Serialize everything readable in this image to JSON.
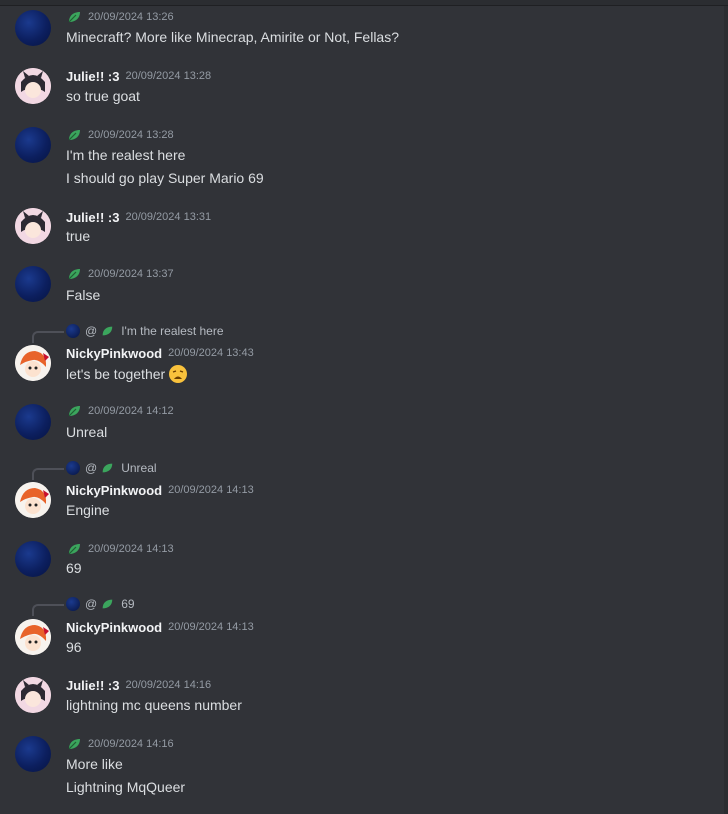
{
  "messages": [
    {
      "avatar": "dark-blue-circle",
      "name": "",
      "badge": "leaf-icon",
      "time": "20/09/2024 13:26",
      "lines": [
        "Minecraft? More like Minecrap, Amirite or Not, Fellas?"
      ]
    },
    {
      "avatar": "julie-avatar",
      "name": "Julie!! :3",
      "time": "20/09/2024 13:28",
      "lines": [
        "so true goat"
      ]
    },
    {
      "avatar": "dark-blue-circle",
      "name": "",
      "badge": "leaf-icon",
      "time": "20/09/2024 13:28",
      "lines": [
        "I'm the realest here",
        "I should go play Super Mario 69"
      ]
    },
    {
      "avatar": "julie-avatar",
      "name": "Julie!! :3",
      "time": "20/09/2024 13:31",
      "lines": [
        "true"
      ]
    },
    {
      "avatar": "dark-blue-circle",
      "name": "",
      "badge": "leaf-icon",
      "time": "20/09/2024 13:37",
      "lines": [
        "False"
      ]
    },
    {
      "avatar": "nicky-avatar",
      "name": "NickyPinkwood",
      "time": "20/09/2024 13:43",
      "reply": {
        "at": "@",
        "text": "I'm the realest here"
      },
      "lines": [
        "let's be together"
      ],
      "emoji": "weary-face-emoji"
    },
    {
      "avatar": "dark-blue-circle",
      "name": "",
      "badge": "leaf-icon",
      "time": "20/09/2024 14:12",
      "lines": [
        "Unreal"
      ]
    },
    {
      "avatar": "nicky-avatar",
      "name": "NickyPinkwood",
      "time": "20/09/2024 14:13",
      "reply": {
        "at": "@",
        "text": "Unreal"
      },
      "lines": [
        "Engine"
      ]
    },
    {
      "avatar": "dark-blue-circle",
      "name": "",
      "badge": "leaf-icon",
      "time": "20/09/2024 14:13",
      "lines": [
        "69"
      ]
    },
    {
      "avatar": "nicky-avatar",
      "name": "NickyPinkwood",
      "time": "20/09/2024 14:13",
      "reply": {
        "at": "@",
        "text": "69"
      },
      "lines": [
        "96"
      ]
    },
    {
      "avatar": "julie-avatar",
      "name": "Julie!! :3",
      "time": "20/09/2024 14:16",
      "lines": [
        "lightning mc queens number"
      ]
    },
    {
      "avatar": "dark-blue-circle",
      "name": "",
      "badge": "leaf-icon",
      "time": "20/09/2024 14:16",
      "lines": [
        "More like",
        "Lightning MqQueer"
      ]
    }
  ],
  "colors": {
    "background": "#313338",
    "text": "#dbdee1",
    "timestamp": "#949ba4",
    "username": "#f2f3f5",
    "leaf": "#3ba55d"
  }
}
